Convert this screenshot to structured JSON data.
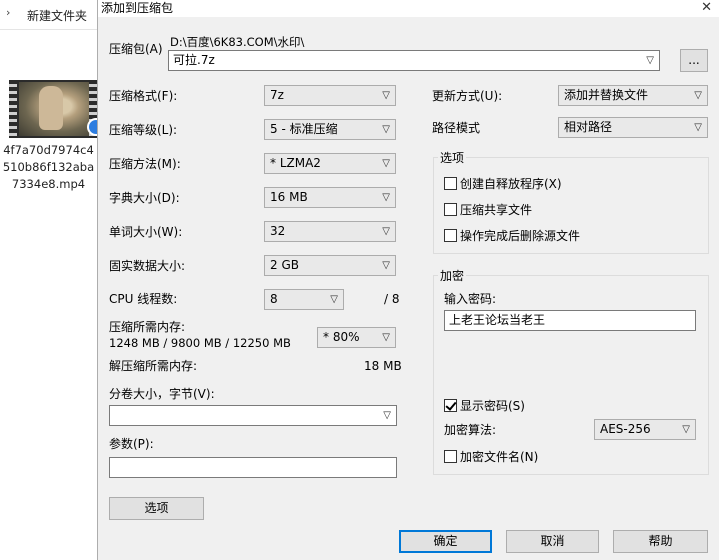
{
  "explorer": {
    "folder_label": "新建文件夹",
    "file_name_lines": [
      "4f7a70d7974c4",
      "510b86f132aba",
      "7334e8.mp4"
    ]
  },
  "dialog": {
    "title": "添加到压缩包",
    "archive": {
      "label": "压缩包(A)",
      "path": "D:\\百度\\6K83.COM\\水印\\",
      "value": "可拉.7z",
      "browse_label": "..."
    },
    "left": {
      "format": {
        "label": "压缩格式(F):",
        "value": "7z"
      },
      "level": {
        "label": "压缩等级(L):",
        "value": "5 - 标准压缩"
      },
      "method": {
        "label": "压缩方法(M):",
        "value": "*  LZMA2"
      },
      "dict": {
        "label": "字典大小(D):",
        "value": "16 MB"
      },
      "word": {
        "label": "单词大小(W):",
        "value": "32"
      },
      "solid": {
        "label": "固实数据大小:",
        "value": "2 GB"
      },
      "threads": {
        "label": "CPU 线程数:",
        "value": "8",
        "total": "/ 8"
      },
      "mem_comp": {
        "label": "压缩所需内存:",
        "detail": "1248 MB / 9800 MB / 12250 MB",
        "value": "* 80%"
      },
      "mem_decomp": {
        "label": "解压缩所需内存:",
        "value": "18 MB"
      },
      "volume": {
        "label": "分卷大小，字节(V):",
        "value": ""
      },
      "params": {
        "label": "参数(P):",
        "value": ""
      },
      "options_button": "选项"
    },
    "right": {
      "update": {
        "label": "更新方式(U):",
        "value": "添加并替换文件"
      },
      "pathmode": {
        "label": "路径模式",
        "value": "相对路径"
      },
      "options_group": {
        "title": "选项",
        "items": [
          {
            "label": "创建自释放程序(X)",
            "checked": false
          },
          {
            "label": "压缩共享文件",
            "checked": false
          },
          {
            "label": "操作完成后删除源文件",
            "checked": false
          }
        ]
      },
      "encrypt_group": {
        "title": "加密",
        "password_label": "输入密码:",
        "password_value": "上老王论坛当老王",
        "show_password": {
          "label": "显示密码(S)",
          "checked": true
        },
        "algo_label": "加密算法:",
        "algo_value": "AES-256",
        "encrypt_names": {
          "label": "加密文件名(N)",
          "checked": false
        }
      }
    },
    "buttons": {
      "ok": "确定",
      "cancel": "取消",
      "help": "帮助"
    }
  }
}
